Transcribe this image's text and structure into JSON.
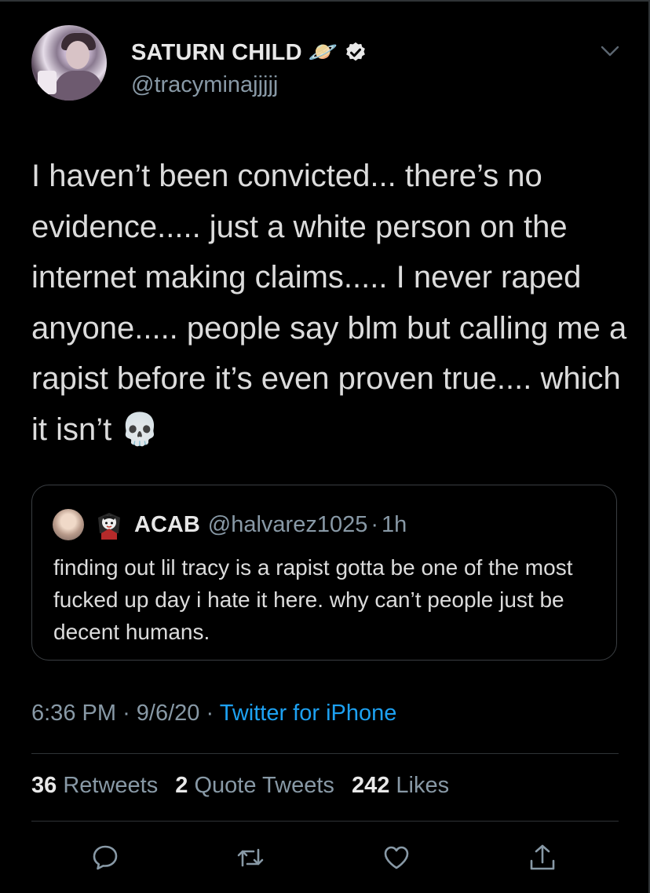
{
  "user": {
    "display_name": "SATURN CHILD",
    "name_emoji": "🪐",
    "handle": "@tracyminajjjjj"
  },
  "tweet": {
    "text": "I haven’t been convicted... there’s no evidence..... just a white person on the internet making claims..... I never raped anyone..... people say blm but calling me a rapist before it’s even proven true.... which it isn’t 💀"
  },
  "quoted_tweet": {
    "display_name": "ACAB",
    "handle": "@halvarez1025",
    "time": "1h",
    "separator": "·",
    "text": "finding out lil tracy is a rapist gotta be one of the most fucked up day i hate it here. why can’t people just be decent humans."
  },
  "meta": {
    "time": "6:36 PM",
    "separator": "·",
    "date": "9/6/20",
    "source": "Twitter for iPhone"
  },
  "stats": {
    "retweets_count": "36",
    "retweets_label": "Retweets",
    "quotes_count": "2",
    "quotes_label": "Quote Tweets",
    "likes_count": "242",
    "likes_label": "Likes"
  },
  "colors": {
    "background": "#000000",
    "secondary_text": "#8899a6",
    "link": "#1da1f2",
    "border": "#2f3336"
  },
  "icons": [
    "verified-icon",
    "chevron-down-icon",
    "reply-icon",
    "retweet-icon",
    "like-icon",
    "share-icon"
  ]
}
